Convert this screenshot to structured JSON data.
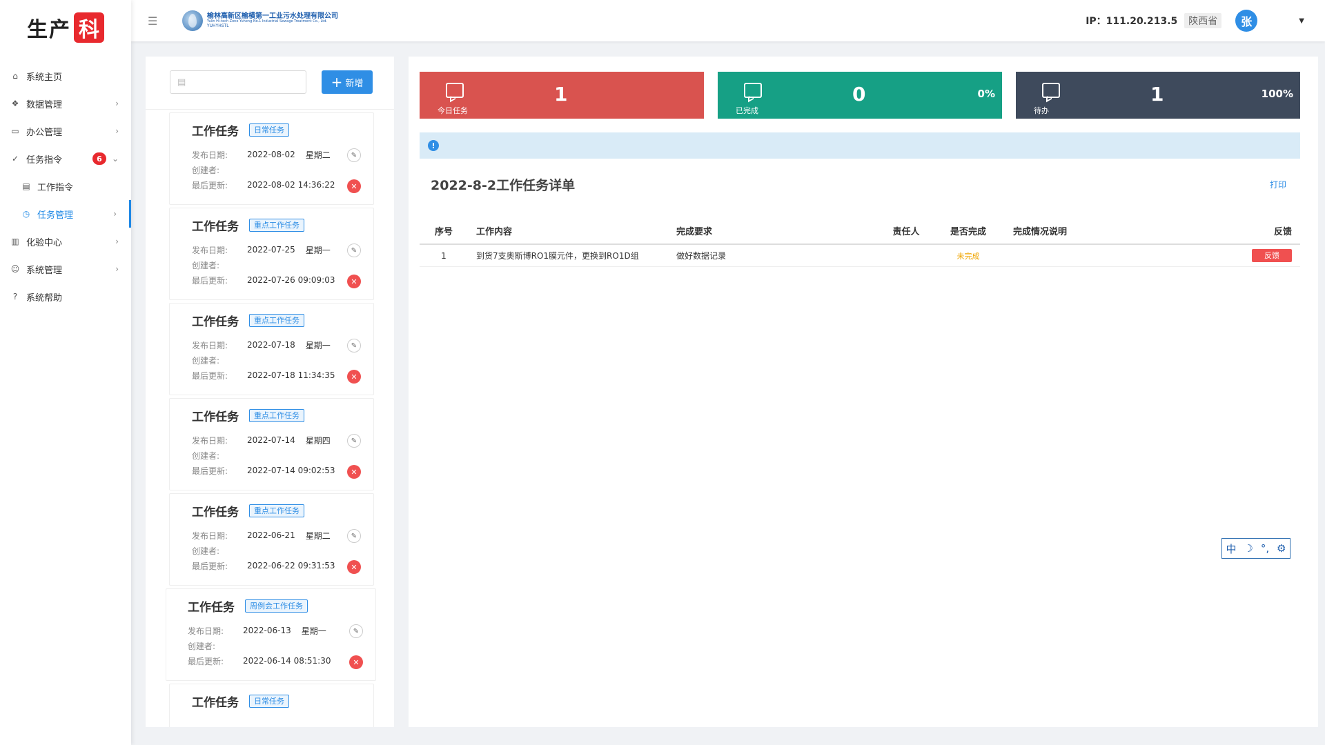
{
  "brand": {
    "text": "生产",
    "badge": "科"
  },
  "sidebar": {
    "items": [
      {
        "label": "系统主页",
        "icon": "home-icon",
        "glyph": "⌂",
        "arrow": ""
      },
      {
        "label": "数据管理",
        "icon": "data-icon",
        "glyph": "❖",
        "arrow": "›"
      },
      {
        "label": "办公管理",
        "icon": "folder-icon",
        "glyph": "▭",
        "arrow": "›"
      },
      {
        "label": "任务指令",
        "icon": "check-circle-icon",
        "glyph": "✓",
        "arrow": "⌄",
        "badge": "6"
      },
      {
        "label": "工作指令",
        "icon": "document-icon",
        "glyph": "▤",
        "arrow": ""
      },
      {
        "label": "任务管理",
        "icon": "clock-icon",
        "glyph": "◷",
        "arrow": "›"
      },
      {
        "label": "化验中心",
        "icon": "lab-icon",
        "glyph": "▥",
        "arrow": "›"
      },
      {
        "label": "系统管理",
        "icon": "users-icon",
        "glyph": "☺",
        "arrow": "›"
      },
      {
        "label": "系统帮助",
        "icon": "help-icon",
        "glyph": "?",
        "arrow": ""
      }
    ]
  },
  "header": {
    "logo_cn": "榆林高新区榆横第一工业污水处理有限公司",
    "logo_en": "Yulin Hi-tech Zone Yuheng No.1 Industrial Sewage Treatment Co., Ltd.",
    "logo_sub": "YUHYHSTL",
    "ip": "IP：111.20.213.5",
    "region": "陕西省",
    "avatar": "张"
  },
  "task_panel": {
    "add_label": "新增",
    "date_placeholder": "",
    "cards": [
      {
        "title": "工作任务",
        "tag": "日常任务",
        "publish_label": "发布日期:",
        "publish_date": "2022-08-02",
        "weekday": "星期二",
        "creator_label": "创建者:",
        "update_label": "最后更新:",
        "update_date": "2022-08-02",
        "update_time": "14:36:22"
      },
      {
        "title": "工作任务",
        "tag": "重点工作任务",
        "publish_label": "发布日期:",
        "publish_date": "2022-07-25",
        "weekday": "星期一",
        "creator_label": "创建者:",
        "update_label": "最后更新:",
        "update_date": "2022-07-26",
        "update_time": "09:09:03"
      },
      {
        "title": "工作任务",
        "tag": "重点工作任务",
        "publish_label": "发布日期:",
        "publish_date": "2022-07-18",
        "weekday": "星期一",
        "creator_label": "创建者:",
        "update_label": "最后更新:",
        "update_date": "2022-07-18",
        "update_time": "11:34:35"
      },
      {
        "title": "工作任务",
        "tag": "重点工作任务",
        "publish_label": "发布日期:",
        "publish_date": "2022-07-14",
        "weekday": "星期四",
        "creator_label": "创建者:",
        "update_label": "最后更新:",
        "update_date": "2022-07-14",
        "update_time": "09:02:53"
      },
      {
        "title": "工作任务",
        "tag": "重点工作任务",
        "publish_label": "发布日期:",
        "publish_date": "2022-06-21",
        "weekday": "星期二",
        "creator_label": "创建者:",
        "update_label": "最后更新:",
        "update_date": "2022-06-22",
        "update_time": "09:31:53"
      },
      {
        "title": "工作任务",
        "tag": "周例会工作任务",
        "publish_label": "发布日期:",
        "publish_date": "2022-06-13",
        "weekday": "星期一",
        "creator_label": "创建者:",
        "update_label": "最后更新:",
        "update_date": "2022-06-14",
        "update_time": "08:51:30"
      },
      {
        "title": "工作任务",
        "tag": "日常任务"
      }
    ]
  },
  "stats": [
    {
      "label": "今日任务",
      "value": "1",
      "pct": "",
      "color": "#d9534f"
    },
    {
      "label": "已完成",
      "value": "0",
      "pct": "0%",
      "color": "#16a085"
    },
    {
      "label": "待办",
      "value": "1",
      "pct": "100%",
      "color": "#3e4a5c"
    }
  ],
  "detail": {
    "title": "2022-8-2工作任务详单",
    "print_label": "打印",
    "columns": [
      "序号",
      "工作内容",
      "完成要求",
      "责任人",
      "是否完成",
      "完成情况说明",
      "反馈"
    ],
    "rows": [
      {
        "no": "1",
        "content": "到货7支奥斯博RO1膜元件，更换到RO1D组",
        "requirement": "做好数据记录",
        "owner": "",
        "status": "未完成",
        "note": "",
        "action": "反馈"
      }
    ]
  },
  "ime": {
    "lang": "中",
    "moon": "☽",
    "punct": "°,",
    "gear": "⚙"
  }
}
